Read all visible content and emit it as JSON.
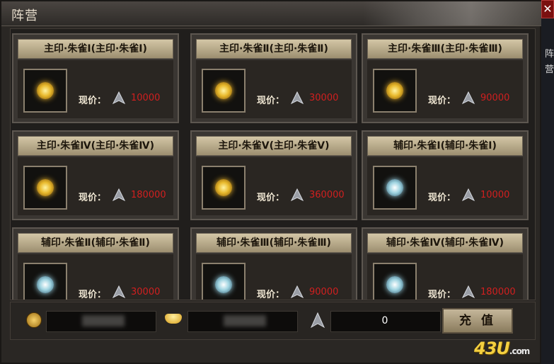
{
  "window": {
    "title": "阵营",
    "close": "✕",
    "side_text": "阵营"
  },
  "cards": [
    {
      "title": "主印·朱雀Ⅰ(主印·朱雀Ⅰ)",
      "price_label": "现价：",
      "price": "10000",
      "icon": "gold-seal-icon"
    },
    {
      "title": "主印·朱雀Ⅱ(主印·朱雀Ⅱ)",
      "price_label": "现价：",
      "price": "30000",
      "icon": "gold-seal-icon"
    },
    {
      "title": "主印·朱雀Ⅲ(主印·朱雀Ⅲ)",
      "price_label": "现价：",
      "price": "90000",
      "icon": "gold-seal-icon"
    },
    {
      "title": "主印·朱雀Ⅳ(主印·朱雀Ⅳ)",
      "price_label": "现价：",
      "price": "180000",
      "icon": "gold-seal-icon"
    },
    {
      "title": "主印·朱雀Ⅴ(主印·朱雀Ⅴ)",
      "price_label": "现价：",
      "price": "360000",
      "icon": "gold-seal-icon"
    },
    {
      "title": "辅印·朱雀Ⅰ(辅印·朱雀Ⅰ)",
      "price_label": "现价：",
      "price": "10000",
      "icon": "silver-seal-icon"
    },
    {
      "title": "辅印·朱雀Ⅱ(辅印·朱雀Ⅱ)",
      "price_label": "现价：",
      "price": "30000",
      "icon": "silver-seal-icon"
    },
    {
      "title": "辅印·朱雀Ⅲ(辅印·朱雀Ⅲ)",
      "price_label": "现价：",
      "price": "90000",
      "icon": "silver-seal-icon"
    },
    {
      "title": "辅印·朱雀Ⅳ(辅印·朱雀Ⅳ)",
      "price_label": "现价：",
      "price": "180000",
      "icon": "silver-seal-icon"
    }
  ],
  "bottom": {
    "currency_amount": "0",
    "recharge_label": "充 值"
  },
  "logo": {
    "brand": "43U",
    "domain": ".com"
  },
  "colors": {
    "price": "#d11f1f",
    "header": "#d3c6a6"
  }
}
